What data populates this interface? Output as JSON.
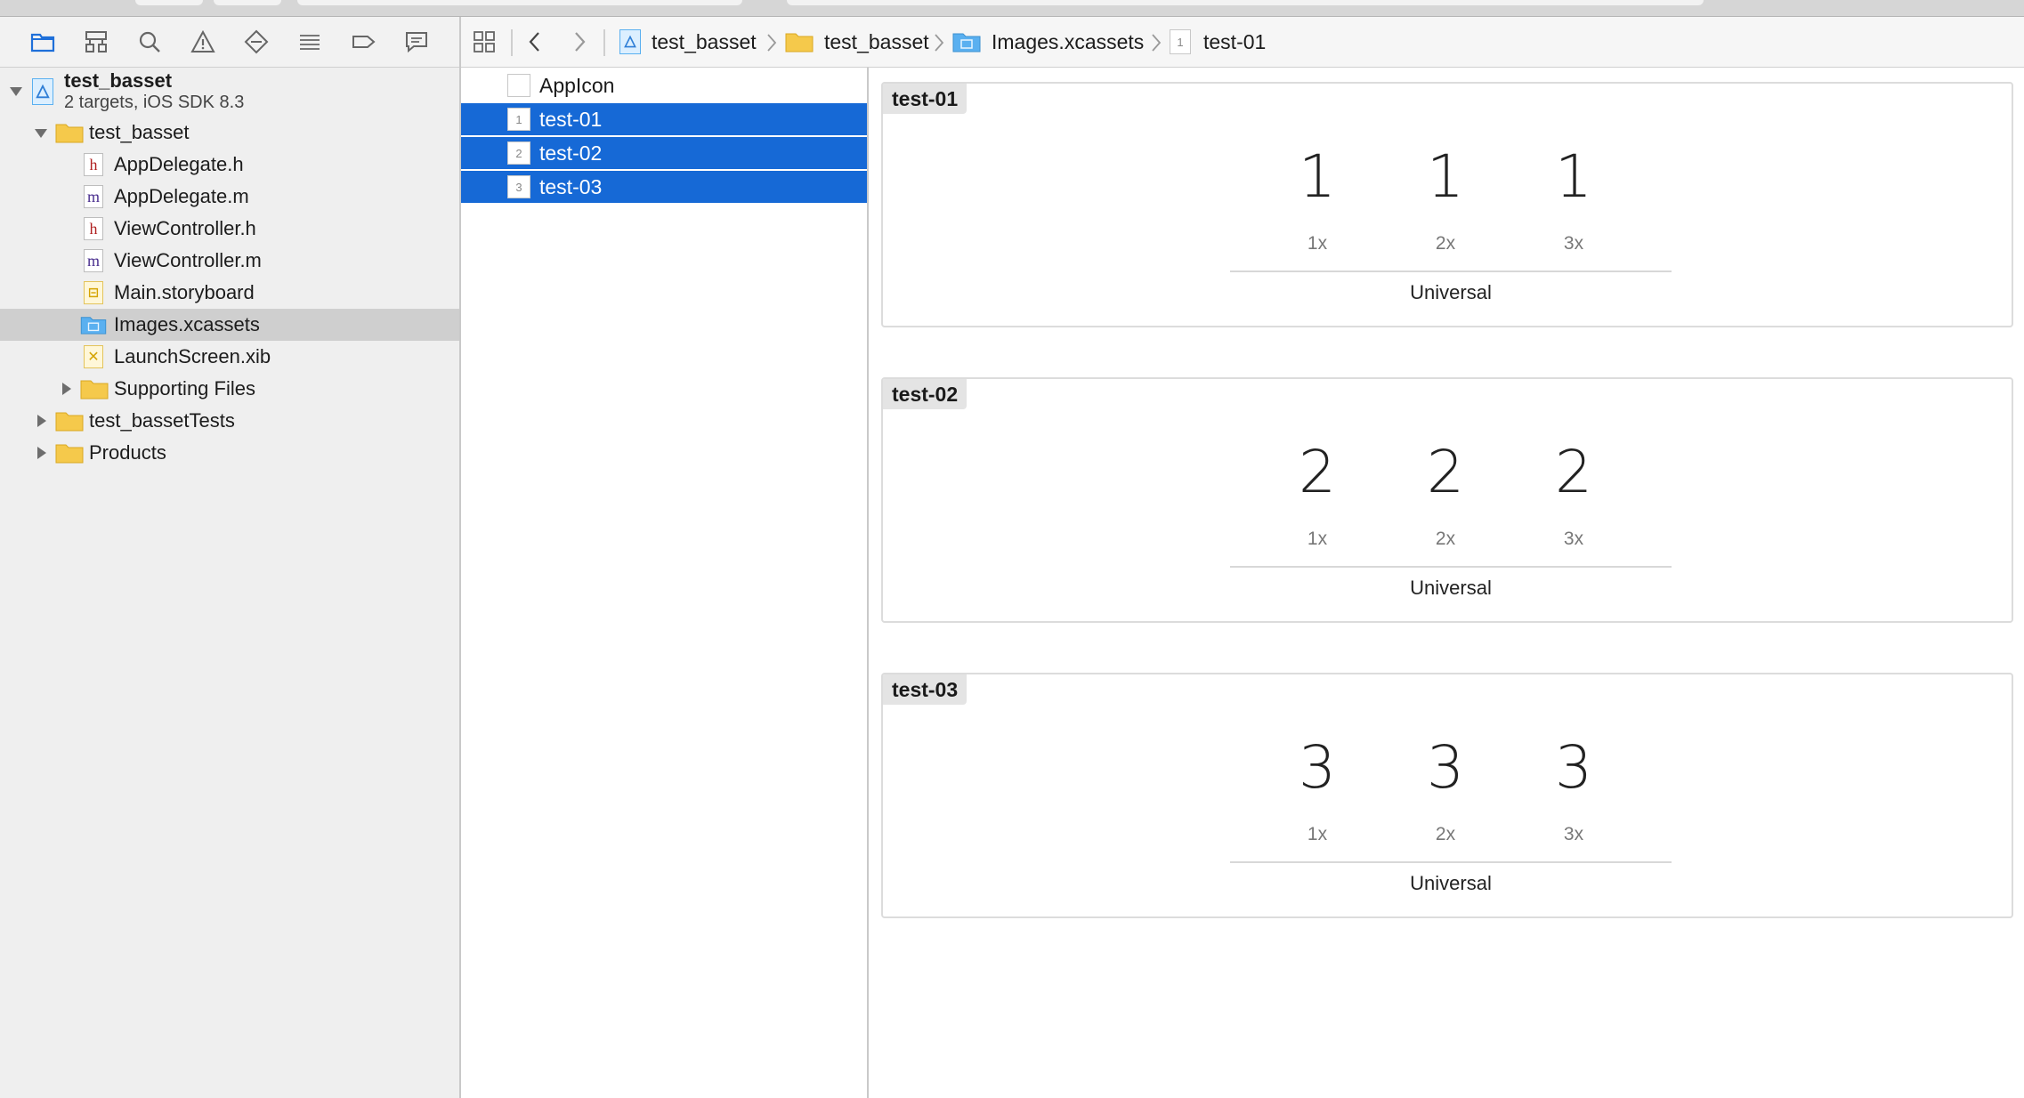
{
  "navigator": {
    "project": {
      "name": "test_basset",
      "subtitle": "2 targets, iOS SDK 8.3"
    },
    "items": [
      {
        "label": "test_basset",
        "kind": "folder"
      },
      {
        "label": "AppDelegate.h",
        "kind": "h"
      },
      {
        "label": "AppDelegate.m",
        "kind": "m"
      },
      {
        "label": "ViewController.h",
        "kind": "h"
      },
      {
        "label": "ViewController.m",
        "kind": "m"
      },
      {
        "label": "Main.storyboard",
        "kind": "storyboard"
      },
      {
        "label": "Images.xcassets",
        "kind": "xcassets",
        "selected": true
      },
      {
        "label": "LaunchScreen.xib",
        "kind": "xib"
      },
      {
        "label": "Supporting Files",
        "kind": "folder"
      },
      {
        "label": "test_bassetTests",
        "kind": "folder"
      },
      {
        "label": "Products",
        "kind": "folder"
      }
    ],
    "file_glyphs": {
      "h": "h",
      "m": "m"
    }
  },
  "jumpbar": {
    "crumbs": [
      "test_basset",
      "test_basset",
      "Images.xcassets",
      "test-01"
    ],
    "crumb_badge": "1"
  },
  "asset_list": {
    "items": [
      {
        "label": "AppIcon",
        "badge": "",
        "selected": false
      },
      {
        "label": "test-01",
        "badge": "1",
        "selected": true
      },
      {
        "label": "test-02",
        "badge": "2",
        "selected": true
      },
      {
        "label": "test-03",
        "badge": "3",
        "selected": true
      }
    ]
  },
  "image_sets": [
    {
      "name": "test-01",
      "glyph": "1",
      "scales": [
        "1x",
        "2x",
        "3x"
      ],
      "idiom": "Universal"
    },
    {
      "name": "test-02",
      "glyph": "2",
      "scales": [
        "1x",
        "2x",
        "3x"
      ],
      "idiom": "Universal"
    },
    {
      "name": "test-03",
      "glyph": "3",
      "scales": [
        "1x",
        "2x",
        "3x"
      ],
      "idiom": "Universal"
    }
  ],
  "colors": {
    "selection": "#1669d6",
    "folder": "#f5c94b",
    "xcassets": "#5ab0f0"
  }
}
